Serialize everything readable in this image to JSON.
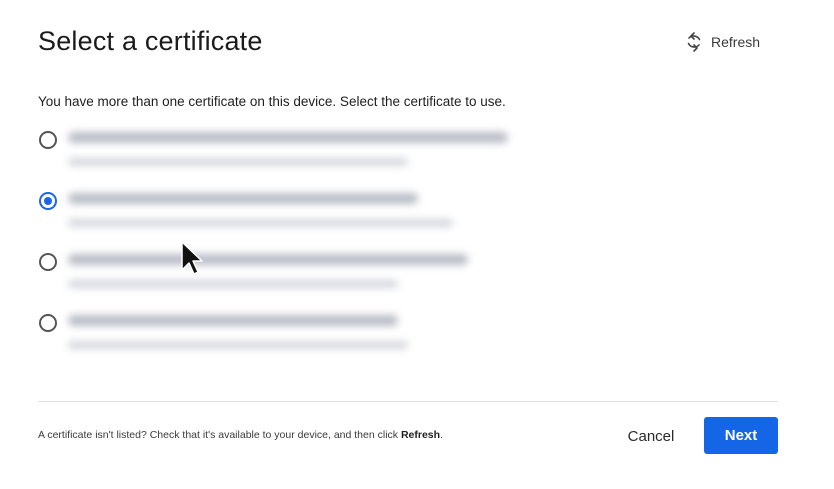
{
  "header": {
    "title": "Select a certificate",
    "refresh_label": "Refresh"
  },
  "main": {
    "instruction": "You have more than one certificate on this device. Select the certificate to use.",
    "certificates": [
      {
        "selected": false,
        "name_redacted": true
      },
      {
        "selected": true,
        "name_redacted": true
      },
      {
        "selected": false,
        "name_redacted": true
      },
      {
        "selected": false,
        "name_redacted": true
      }
    ]
  },
  "footer": {
    "note_prefix": "A certificate isn't listed? Check that it's available to your device, and then click ",
    "note_emphasis": "Refresh",
    "note_suffix": ".",
    "cancel_label": "Cancel",
    "next_label": "Next"
  },
  "icons": {
    "refresh": "refresh-icon",
    "cursor": "mouse-pointer-icon"
  },
  "colors": {
    "accent": "#1466e6",
    "text": "#1f1f1f",
    "divider": "#e2e2e2"
  }
}
